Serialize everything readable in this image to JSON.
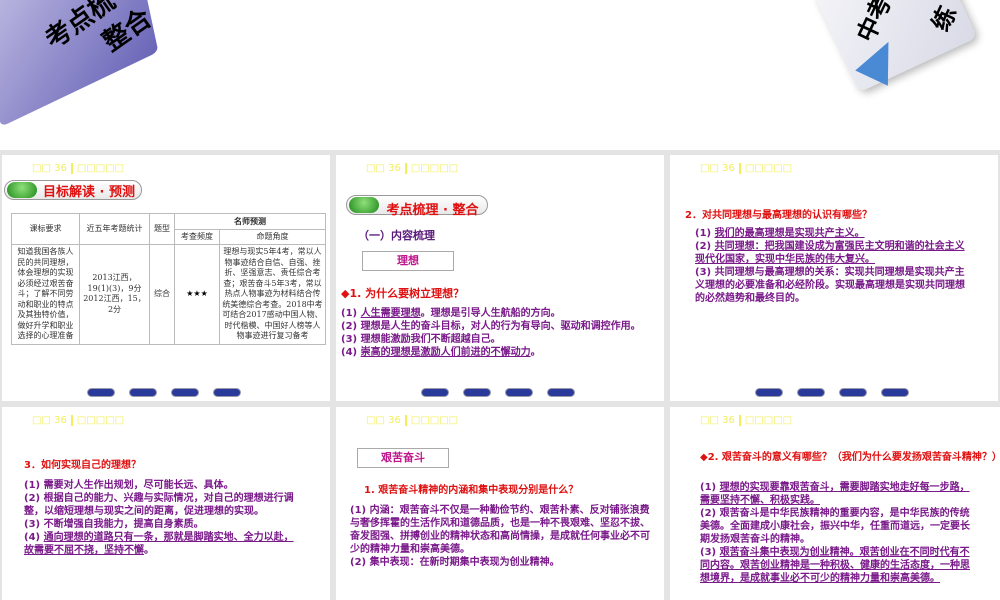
{
  "banner": {
    "left_title": [
      "考点梳",
      "整合"
    ],
    "right_title": [
      "中考",
      "练"
    ]
  },
  "slide_header": {
    "prefix": "□□ 36",
    "suffix": "□□□□□"
  },
  "slide1": {
    "pill": "目标解读 · 预测",
    "table": {
      "h_req": "课标要求",
      "h_stat": "近五年考题统计",
      "h_type": "题型",
      "h_pred": "名师预测",
      "h_freq": "考查频度",
      "h_angle": "命题角度",
      "req": "知道我国各族人民的共同理想，体会理想的实现必须经过艰苦奋斗；了解不同劳动和职业的特点及其独特价值，做好升学和职业选择的心理准备",
      "stat": "2013江西，19(1)(3)，9分 2012江西，15，2分",
      "type": "综合",
      "freq": "★★★",
      "angle": "理想与现实5年4考，常以人物事迹结合自信、自强、挫折、坚强意志、责任综合考查；艰苦奋斗5年3考，常以热点人物事迹为材料结合传统美德综合考查。2018中考可结合2017感动中国人物、时代楷模、中国好人榜等人物事迹进行复习备考"
    }
  },
  "slide2": {
    "pill": "考点梳理 · 整合",
    "sub": "（一）内容梳理",
    "box": "理想",
    "q": "◆1. 为什么要树立理想？",
    "items": [
      "(1) ",
      "人生需要理想",
      "。理想是引导人生航船的方向。",
      "(2) 理想是人生的奋斗目标，对人的行为有导向、驱动和调控作用。",
      "(3) 理想能激励我们不断超越自己。",
      "(4) ",
      "崇高的理想是激励人们前进的不懈动力",
      "。"
    ]
  },
  "slide3": {
    "q": "2．对共同理想与最高理想的认识有哪些？",
    "items": [
      "(1) ",
      "我们的最高理想是实现共产主义。",
      "(2) ",
      "共同理想：把我国建设成为富强民主文明和谐的社会主义现代化国家，实现中华民族的伟大复兴。",
      "(3) 共同理想与最高理想的关系：实现共同理想是实现共产主义理想的必要准备和必经阶段。实现最高理想是实现共同理想的必然趋势和最终目的。"
    ]
  },
  "slide4": {
    "q": "3．如何实现自己的理想？",
    "items": [
      "(1) 需要对人生作出规划，尽可能长远、具体。",
      "(2) 根据自己的能力、兴趣与实际情况，对自己的理想进行调整，以缩短理想与现实之间的距离，促进理想的实现。",
      "(3) 不断增强自我能力，提高自身素质。",
      "(4) ",
      "通向理想的道路只有一条，那就是脚踏实地、全力以赴，故需要不屈不挠，坚持不懈",
      "。"
    ]
  },
  "slide5": {
    "box": "艰苦奋斗",
    "q": "1. 艰苦奋斗精神的内涵和集中表现分别是什么？",
    "items": [
      "(1) 内涵：艰苦奋斗不仅是一种勤俭节约、艰苦朴素、反对铺张浪费与奢侈挥霍的生活作风和道德品质，也是一种不畏艰难、坚忍不拔、奋发图强、拼搏创业的精神状态和高尚情操，是成就任何事业必不可少的精神力量和崇高美德。",
      "(2) 集中表现：在新时期集中表现为创业精神。"
    ]
  },
  "slide6": {
    "q": "◆2. 艰苦奋斗的意义有哪些？（我们为什么要发扬艰苦奋斗精神？）",
    "items": [
      "(1) ",
      "理想的实现要靠艰苦奋斗，需要脚踏实地走好每一步路，需要坚持不懈、积极实践。",
      "(2) 艰苦奋斗是中华民族精神的重要内容，是中华民族的传统美德。全面建成小康社会，振兴中华，任重而道远，一定要长期发扬艰苦奋斗的精神。",
      "(3) ",
      "艰苦奋斗集中表现为创业精神。艰苦创业在不同时代有不同内容。艰苦创业精神是一种积极、健康的生活态度，一种思想境界，是成就事业必不可少的精神力量和崇高美德。"
    ]
  }
}
